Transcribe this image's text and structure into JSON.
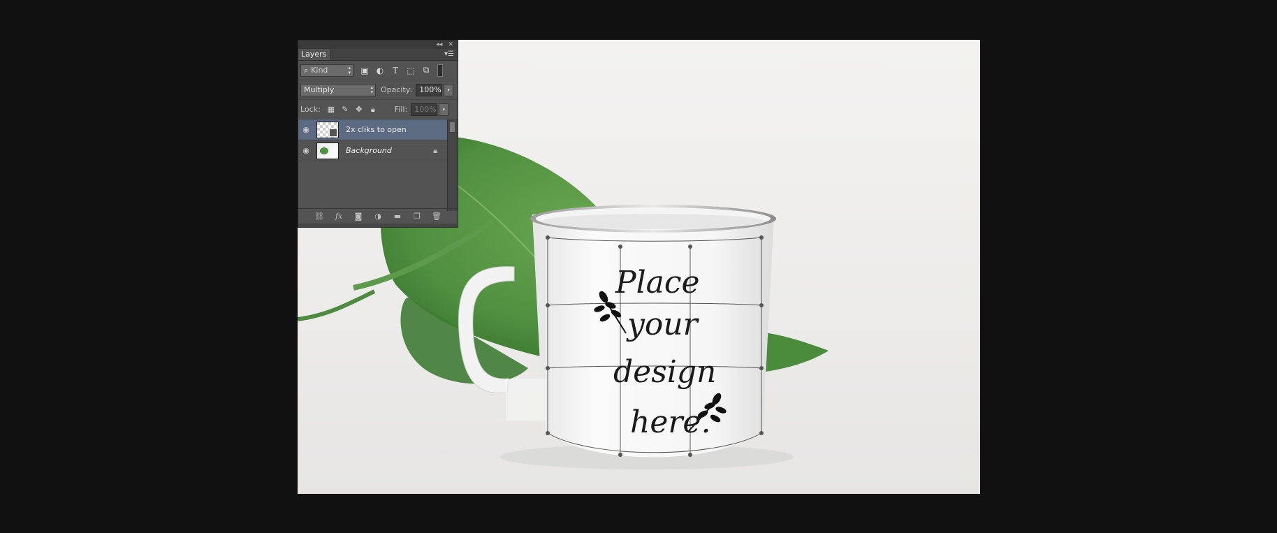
{
  "panel": {
    "title": "Layers",
    "kind_filter": "Kind",
    "blend_mode": "Multiply",
    "opacity_label": "Opacity:",
    "opacity_value": "100%",
    "lock_label": "Lock:",
    "fill_label": "Fill:",
    "fill_value": "100%",
    "filter_icons": [
      "image-filter-icon",
      "adjustment-filter-icon",
      "type-filter-icon",
      "shape-filter-icon",
      "smart-object-filter-icon"
    ],
    "lock_icons": [
      "lock-transparent-icon",
      "lock-paint-icon",
      "lock-position-icon",
      "lock-all-icon"
    ],
    "layers": [
      {
        "name": "2x cliks to open",
        "selected": true,
        "italic": false,
        "locked": false
      },
      {
        "name": "Background",
        "selected": false,
        "italic": true,
        "locked": true
      }
    ],
    "bottom_icons": [
      "link-layers-icon",
      "fx-icon",
      "add-mask-icon",
      "adjustment-layer-icon",
      "new-group-icon",
      "new-layer-icon",
      "delete-layer-icon"
    ]
  },
  "mug_text": {
    "line1": "Place",
    "line2": "your",
    "line3": "design",
    "line4": "here."
  },
  "colors": {
    "workspace_bg": "#111111",
    "panel_bg": "#535353",
    "selected_layer": "#5c6b82",
    "leaf_green": "#4f8f3f",
    "mug_white": "#f7f7f7"
  }
}
